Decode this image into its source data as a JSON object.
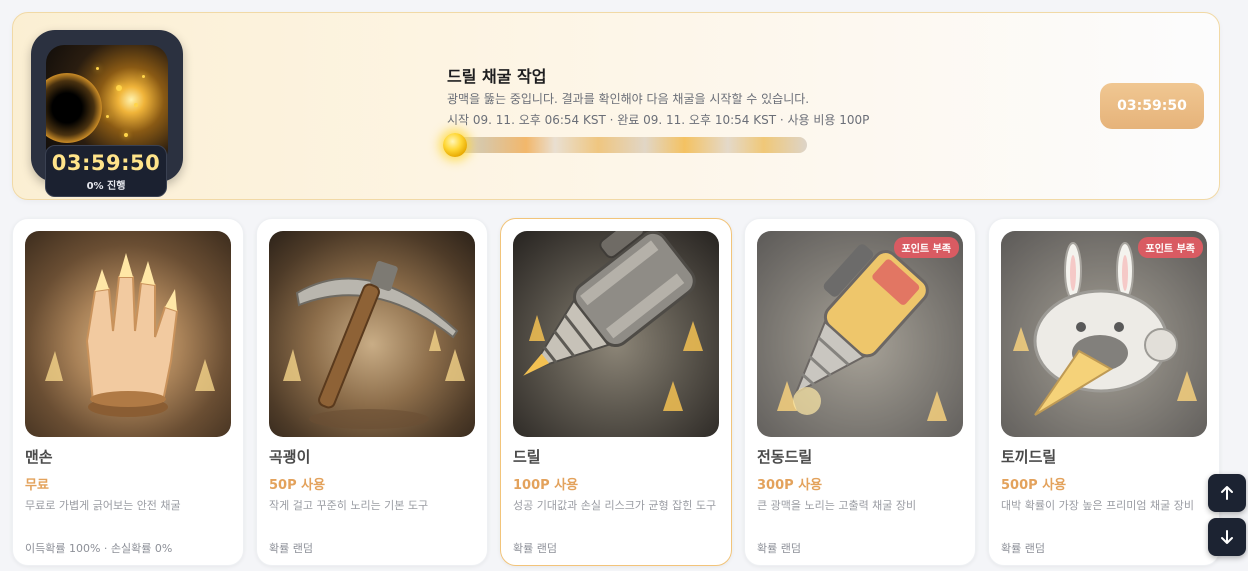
{
  "banner": {
    "timer": "03:59:50",
    "progress_label": "0% 진행",
    "progress_fraction": 0.0,
    "title": "드릴 채굴 작업",
    "description": "광맥을 뚫는 중입니다. 결과를 확인해야 다음 채굴을 시작할 수 있습니다.",
    "meta": "시작 09. 11. 오후 06:54 KST · 완료 09. 11. 오후 10:54 KST · 사용 비용 100P",
    "timer_button": "03:59:50"
  },
  "cards": [
    {
      "name": "맨손",
      "cost": "무료",
      "description": "무료로 가볍게 긁어보는 안전 채굴",
      "probability": "이득확률 100% · 손실확률 0%",
      "badge": ""
    },
    {
      "name": "곡괭이",
      "cost": "50P 사용",
      "description": "작게 걸고 꾸준히 노리는 기본 도구",
      "probability": "확률 랜덤",
      "badge": ""
    },
    {
      "name": "드릴",
      "cost": "100P 사용",
      "description": "성공 기대값과 손실 리스크가 균형 잡힌 도구",
      "probability": "확률 랜덤",
      "badge": ""
    },
    {
      "name": "전동드릴",
      "cost": "300P 사용",
      "description": "큰 광맥을 노리는 고출력 채굴 장비",
      "probability": "확률 랜덤",
      "badge": "포인트 부족"
    },
    {
      "name": "토끼드릴",
      "cost": "500P 사용",
      "description": "대박 확률이 가장 높은 프리미엄 채굴 장비",
      "probability": "확률 랜덤",
      "badge": "포인트 부족"
    }
  ],
  "scroll": {
    "up_icon": "arrow-up-icon",
    "down_icon": "arrow-down-icon"
  },
  "colors": {
    "accent": "#e3a25c",
    "badge_red": "#d95b62",
    "timer_yellow": "#ffe48a",
    "dark_button": "#1c2332"
  }
}
